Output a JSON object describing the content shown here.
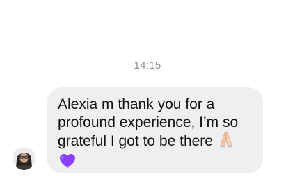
{
  "conversation": {
    "timestamp": "14:15",
    "message": {
      "text": "Alexia m thank you for a\nprofound experience, I’m so\ngrateful I got to be there",
      "emojis": [
        "folded-hands-emoji",
        "purple-heart-emoji"
      ],
      "bubble_color": "#efefef",
      "text_color": "#111111"
    },
    "avatar": "profile-photo"
  },
  "colors": {
    "background": "#ffffff",
    "timestamp": "#8e8e8e",
    "heart": "#8a3ffc"
  }
}
